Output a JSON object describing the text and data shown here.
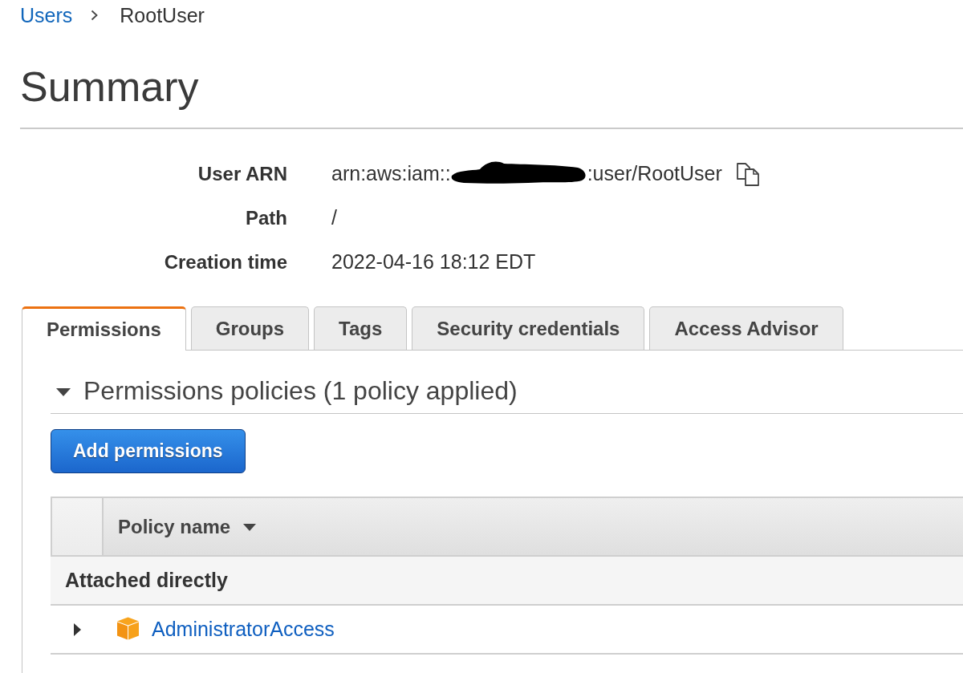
{
  "breadcrumb": [
    {
      "label": "Users",
      "kind": "link"
    },
    {
      "label": "RootUser",
      "kind": "current"
    }
  ],
  "page_title": "Summary",
  "details": [
    {
      "label": "User ARN",
      "kind": "arn",
      "prefix": "arn:aws:iam::",
      "suffix": ":user/RootUser",
      "redacted": true
    },
    {
      "label": "Path",
      "kind": "text",
      "value": "/"
    },
    {
      "label": "Creation time",
      "kind": "text",
      "value": "2022-04-16 18:12 EDT"
    }
  ],
  "tabs": [
    {
      "label": "Permissions",
      "selected": true
    },
    {
      "label": "Groups",
      "selected": false
    },
    {
      "label": "Tags",
      "selected": false
    },
    {
      "label": "Security credentials",
      "selected": false
    },
    {
      "label": "Access Advisor",
      "selected": false
    }
  ],
  "permissions_policies": {
    "title": "Permissions policies (1 policy applied)",
    "expanded": true,
    "button": "Add permissions",
    "table": {
      "columns": [
        "Policy name"
      ],
      "groups": [
        {
          "label": "Attached directly",
          "rows": [
            {
              "policy_name": "AdministratorAccess",
              "expanded": false
            }
          ]
        }
      ]
    }
  }
}
